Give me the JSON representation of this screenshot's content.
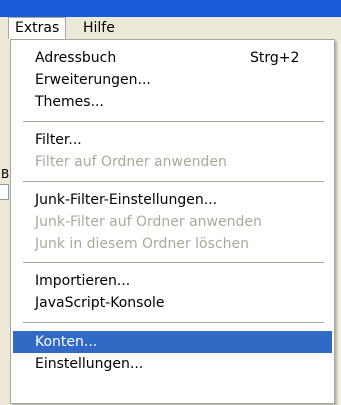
{
  "menubar": {
    "items": [
      {
        "label": "Extras",
        "active": true
      },
      {
        "label": "Hilfe",
        "active": false
      }
    ]
  },
  "background": {
    "left_fragment_text": "B"
  },
  "menu": {
    "groups": [
      {
        "items": [
          {
            "label": "Adressbuch",
            "shortcut": "Strg+2",
            "enabled": true
          },
          {
            "label": "Erweiterungen...",
            "enabled": true
          },
          {
            "label": "Themes...",
            "enabled": true
          }
        ]
      },
      {
        "items": [
          {
            "label": "Filter...",
            "enabled": true
          },
          {
            "label": "Filter auf Ordner anwenden",
            "enabled": false
          }
        ]
      },
      {
        "items": [
          {
            "label": "Junk-Filter-Einstellungen...",
            "enabled": true
          },
          {
            "label": "Junk-Filter auf Ordner anwenden",
            "enabled": false
          },
          {
            "label": "Junk in diesem Ordner löschen",
            "enabled": false
          }
        ]
      },
      {
        "items": [
          {
            "label": "Importieren...",
            "enabled": true
          },
          {
            "label": "JavaScript-Konsole",
            "enabled": true
          }
        ]
      },
      {
        "items": [
          {
            "label": "Konten...",
            "enabled": true,
            "selected": true
          },
          {
            "label": "Einstellungen...",
            "enabled": true
          }
        ]
      }
    ]
  },
  "colors": {
    "selection": "#316ac5",
    "disabled_text": "#aca899",
    "menu_background": "#ffffff",
    "menubar_background": "#ece9d8"
  }
}
